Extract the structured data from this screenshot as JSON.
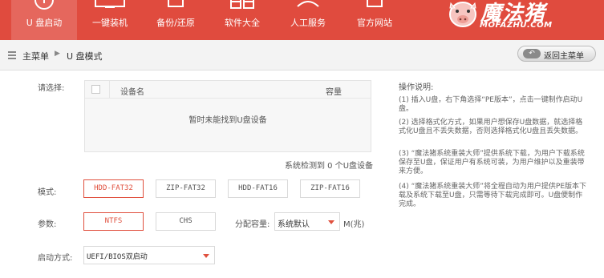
{
  "nav": {
    "items": [
      {
        "label": "U 盘启动",
        "icon": "usb-icon"
      },
      {
        "label": "一键装机",
        "icon": "monitor-icon"
      },
      {
        "label": "备份/还原",
        "icon": "backup-icon"
      },
      {
        "label": "软件大全",
        "icon": "apps-icon"
      },
      {
        "label": "人工服务",
        "icon": "person-icon"
      },
      {
        "label": "官方网站",
        "icon": "home-icon"
      }
    ],
    "logo_text": "魔法猪",
    "logo_sub": "MOFAZHU.COM"
  },
  "breadcrumb": {
    "home": "主菜单",
    "separator": "▶",
    "current": "U 盘模式",
    "back_label": "返回主菜单"
  },
  "device": {
    "select_label": "请选择:",
    "col_name": "设备名",
    "col_capacity": "容量",
    "empty_text": "暂时未能找到U盘设备",
    "status_text": "系统检测到 0 个U盘设备"
  },
  "mode": {
    "label": "模式:",
    "options": [
      "HDD-FAT32",
      "ZIP-FAT32",
      "HDD-FAT16",
      "ZIP-FAT16"
    ],
    "selected": "HDD-FAT32"
  },
  "params": {
    "label": "参数:",
    "options": [
      "NTFS",
      "CHS"
    ],
    "selected": "NTFS",
    "alloc_label": "分配容量:",
    "alloc_value": "系统默认",
    "alloc_unit": "M(兆)"
  },
  "boot": {
    "label": "启动方式:",
    "value": "UEFI/BIOS双启动"
  },
  "help": {
    "title": "操作说明:",
    "paragraphs": [
      "(1) 插入U盘，右下角选择“PE版本”，点击一键制作启动U盘。",
      "(2) 选择格式化方式，如果用户想保存U盘数据，就选择格式化U盘且不丢失数据，否则选择格式化U盘且丢失数据。",
      "(3) “魔法猪系统重装大师”提供系统下载，为用户下载系统保存至U盘，保证用户有系统可装，为用户维护以及重装带来方便。",
      "(4) “魔法猪系统重装大师”将全程自动为用户提供PE版本下载及系统下载至U盘，只需等待下载完成即可。U盘便制作完成。"
    ]
  },
  "colors": {
    "brand": "#e04b3e",
    "accent": "#e0503e"
  }
}
